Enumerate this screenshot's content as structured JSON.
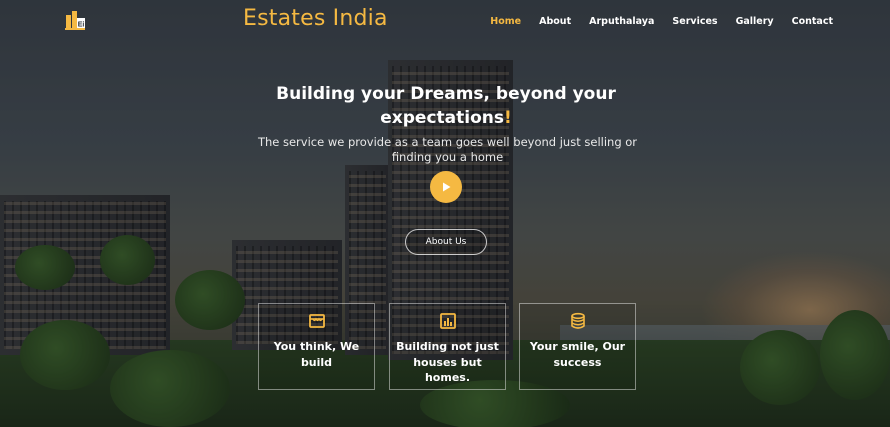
{
  "nav": {
    "logo_text": "Ei",
    "brand": "Estates India",
    "items": [
      {
        "label": "Home",
        "active": true
      },
      {
        "label": "About",
        "active": false
      },
      {
        "label": "Arputhalaya",
        "active": false
      },
      {
        "label": "Services",
        "active": false
      },
      {
        "label": "Gallery",
        "active": false
      },
      {
        "label": "Contact",
        "active": false
      }
    ]
  },
  "hero": {
    "headline": "Building your Dreams, beyond your expectations",
    "headline_accent": "!",
    "subtext": "The service we provide as a team goes well beyond just selling or finding you a home",
    "play_icon": "play-icon",
    "about_button": "About Us"
  },
  "features": [
    {
      "icon": "store-icon",
      "text": "You think, We build"
    },
    {
      "icon": "bar-chart-icon",
      "text": "Building not just houses but homes."
    },
    {
      "icon": "database-icon",
      "text": "Your smile, Our success"
    }
  ],
  "colors": {
    "accent": "#f5b942",
    "text": "#ffffff"
  }
}
